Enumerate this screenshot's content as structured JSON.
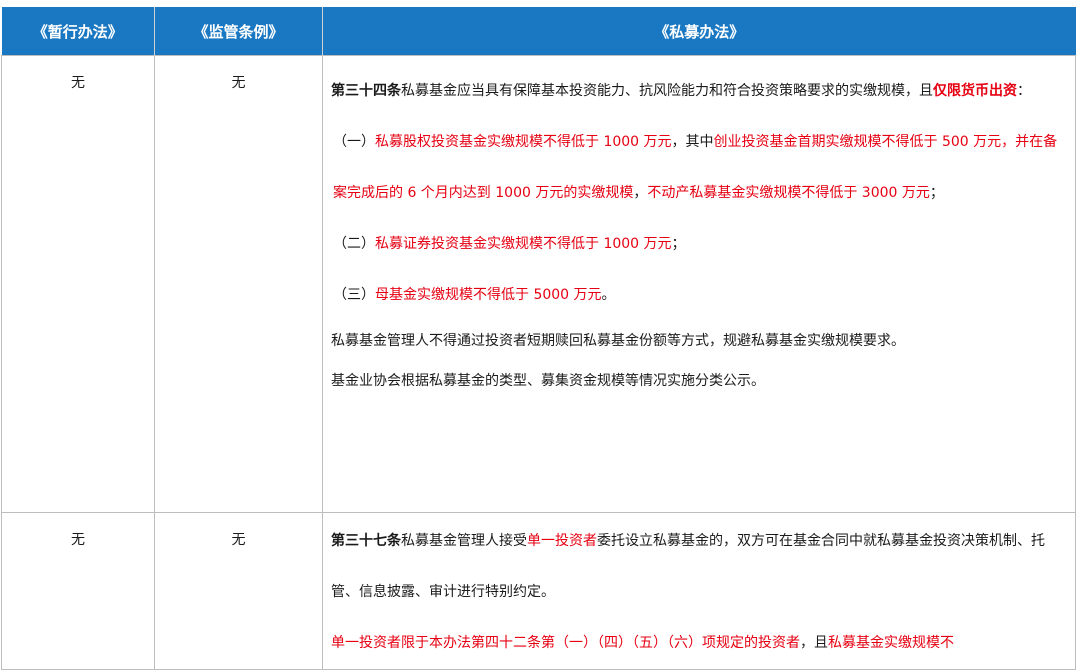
{
  "header": {
    "col1": "《暂行办法》",
    "col2": "《监管条例》",
    "col3": "《私募办法》"
  },
  "rows": [
    {
      "col1": "无",
      "col2": "无",
      "art34": {
        "title": "第三十四条",
        "t1": "私募基金应当具有保障基本投资能力、抗风险能力和符合投资策略要求的实缴规模，且",
        "t1_em": "仅限货币出资",
        "t1_end": "：",
        "i1_pre": "（一）",
        "i1_a": "私募股权投资基金实缴规模不得低于 1000 万元",
        "i1_mid": "，其中",
        "i1_b": "创业投资基金首期实缴规模不得低于 500 万元，并在备案完成后的 6 个月内达到 1000 万元的实缴规模",
        "i1_comma": "，",
        "i1_c": "不动产私募基金实缴规模不得低于 3000 万元",
        "i1_end": "；",
        "i2_pre": "（二）",
        "i2": "私募证券投资基金实缴规模不得低于 1000 万元",
        "i2_end": "；",
        "i3_pre": "（三）",
        "i3": "母基金实缴规模不得低于 5000 万元",
        "i3_end": "。",
        "p1": "私募基金管理人不得通过投资者短期赎回私募基金份额等方式，规避私募基金实缴规模要求。",
        "p2": "基金业协会根据私募基金的类型、募集资金规模等情况实施分类公示。"
      }
    },
    {
      "col1": "无",
      "col2": "无",
      "art37": {
        "title": "第三十七条",
        "t1": "私募基金管理人接受",
        "t1_em": "单一投资者",
        "t1_rest": "委托设立私募基金的，双方可在基金合同中就私募基金投资决策机制、托管、信息披露、审计进行特别约定。",
        "p1_red": "单一投资者限于本办法第四十二条第（一）（四）（五）（六）项规定的投资者",
        "p1_mid": "，且",
        "p1_red2": "私募基金实缴规模不"
      }
    }
  ],
  "colors": {
    "header_bg": "#1a78c2",
    "emphasis_red": "#e60012",
    "border": "#bdbdbd"
  }
}
